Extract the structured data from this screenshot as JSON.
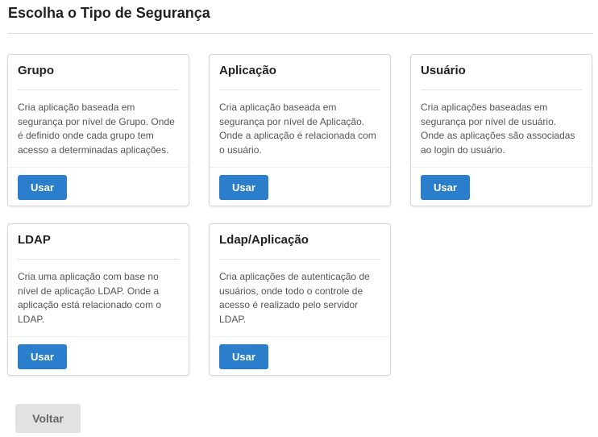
{
  "page": {
    "title": "Escolha o Tipo de Segurança"
  },
  "cards": [
    {
      "title": "Grupo",
      "description": "Cria aplicação baseada em segurança por nível de Grupo. Onde é definido onde cada grupo tem acesso a determinadas aplicações.",
      "button_label": "Usar"
    },
    {
      "title": "Aplicação",
      "description": "Cria aplicação baseada em segurança por nível de Aplicação. Onde a aplicação é relacionada com o usuário.",
      "button_label": "Usar"
    },
    {
      "title": "Usuário",
      "description": "Cria aplicações baseadas em segurança por nível de usuário. Onde as aplicações são associadas ao login do usuário.",
      "button_label": "Usar"
    },
    {
      "title": "LDAP",
      "description": "Cria uma aplicação com base no nível de aplicação LDAP. Onde a aplicação está relacionado com o LDAP.",
      "button_label": "Usar"
    },
    {
      "title": "Ldap/Aplicação",
      "description": "Cria aplicações de autenticação de usuários, onde todo o controle de acesso é realizado pelo servidor LDAP.",
      "button_label": "Usar"
    }
  ],
  "footer": {
    "back_label": "Voltar"
  },
  "colors": {
    "primary_button": "#2b7ecb",
    "secondary_button": "#e2e2e2"
  }
}
